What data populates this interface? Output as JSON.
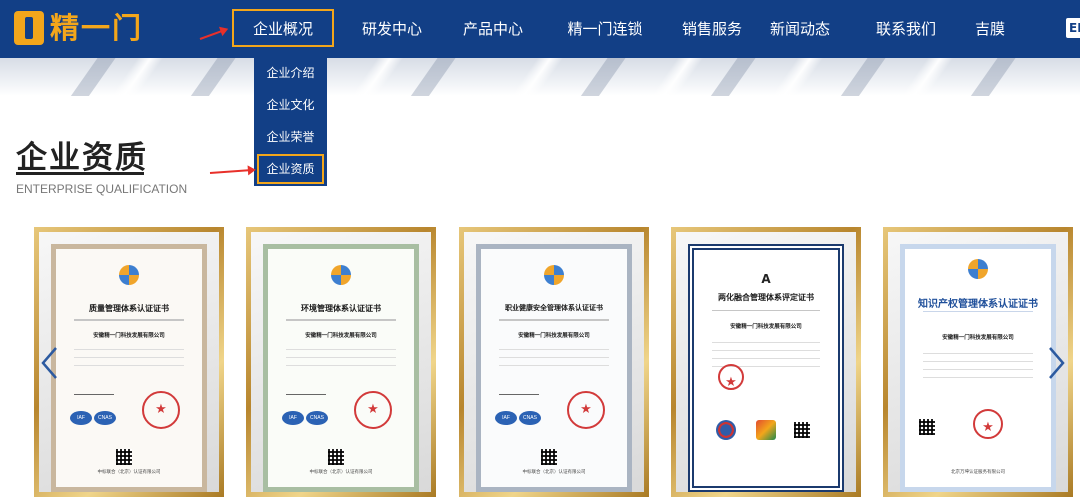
{
  "brand": {
    "name": "精一门",
    "accent": "#f3a61b",
    "nav_bg": "#123f86"
  },
  "nav": {
    "items": [
      "企业概况",
      "研发中心",
      "产品中心",
      "精一门连锁",
      "销售服务",
      "新闻动态",
      "联系我们",
      "吉膜"
    ],
    "lang_label": "EN",
    "active": "企业概况"
  },
  "dropdown": {
    "items": [
      "企业介绍",
      "企业文化",
      "企业荣誉",
      "企业资质"
    ],
    "active": "企业资质"
  },
  "section": {
    "title": "企业资质",
    "subtitle": "ENTERPRISE QUALIFICATION"
  },
  "certificates": [
    {
      "title": "质量管理体系认证证书",
      "company": "安徽精一门科技发展有限公司",
      "footer": "中标联合（北京）认证有限公司",
      "badge1": "IAF",
      "badge2": "CNAS"
    },
    {
      "title": "环境管理体系认证证书",
      "company": "安徽精一门科技发展有限公司",
      "footer": "中标联合（北京）认证有限公司",
      "badge1": "IAF",
      "badge2": "CNAS"
    },
    {
      "title": "职业健康安全管理体系认证证书",
      "company": "安徽精一门科技发展有限公司",
      "footer": "中标联合（北京）认证有限公司",
      "badge1": "IAF",
      "badge2": "CNAS"
    },
    {
      "grade": "A",
      "title": "两化融合管理体系评定证书",
      "company": "安徽精一门科技发展有限公司"
    },
    {
      "title": "知识产权管理体系认证证书",
      "company": "安徽精一门科技发展有限公司",
      "footer": "北京万坤认证服务有限公司"
    }
  ],
  "icons": {
    "prev": "chevron-left-icon",
    "next": "chevron-right-icon"
  }
}
